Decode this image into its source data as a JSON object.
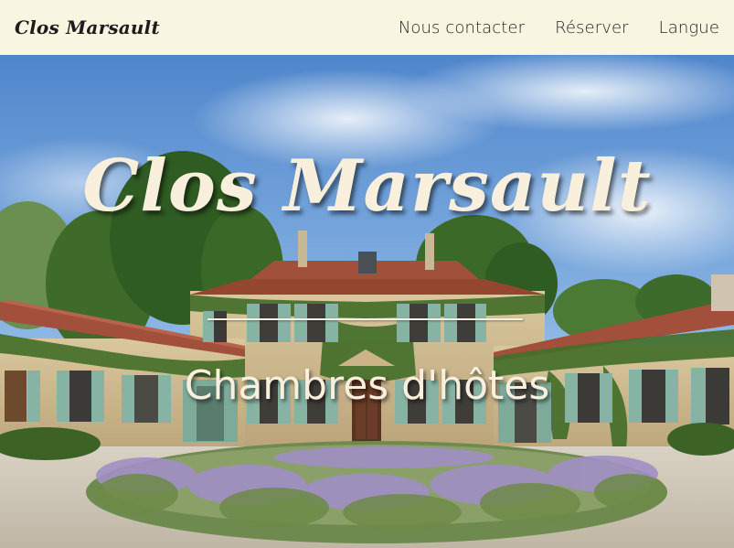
{
  "header": {
    "brand": "Clos Marsault",
    "nav": {
      "contact": "Nous contacter",
      "book": "Réserver",
      "language": "Langue"
    }
  },
  "hero": {
    "title": "Clos Marsault",
    "subtitle": "Chambres d'hôtes",
    "image_description_icon": "manor-house-photo"
  },
  "colors": {
    "header_bg": "#f8f5e1",
    "hero_text": "#f8efdc",
    "sky": "#6f9fd6",
    "roof": "#a2503b",
    "shutters": "#7fae9f",
    "stone": "#cfb88a",
    "lavender": "#9d8bc2",
    "foliage": "#4f7a2e"
  }
}
